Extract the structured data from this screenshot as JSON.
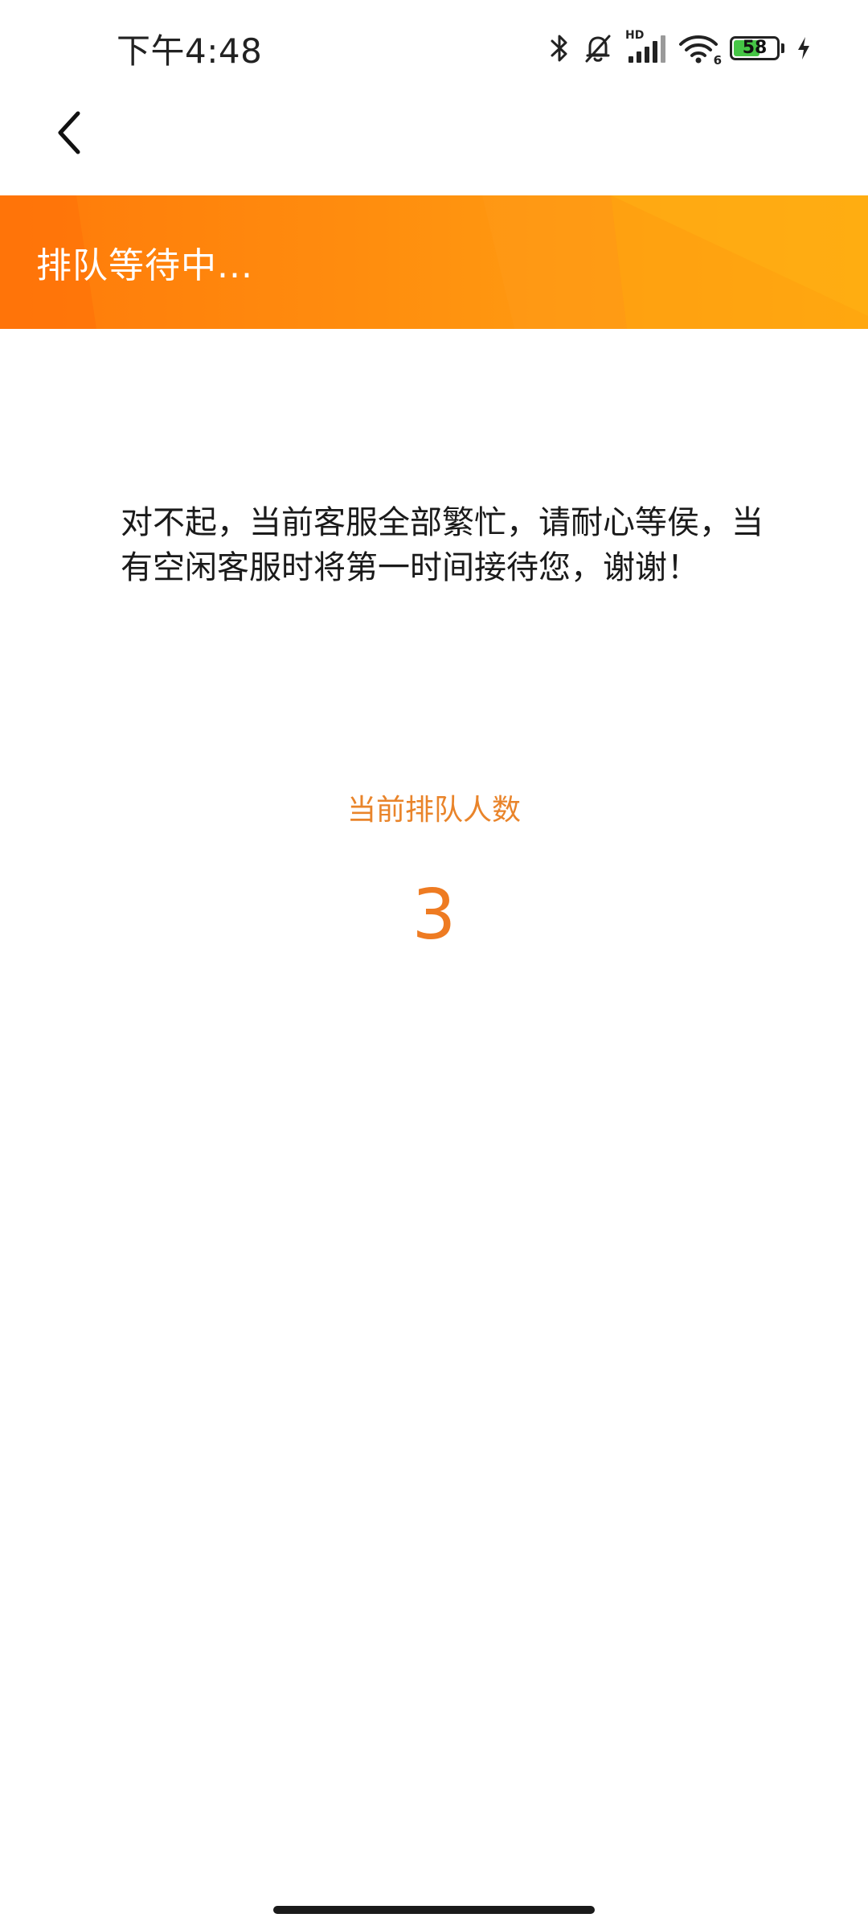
{
  "status_bar": {
    "time": "下午4:48",
    "network_label": "HD",
    "wifi_label": "6",
    "battery_level": "58",
    "battery_fraction": 0.58
  },
  "nav": {
    "back_icon": "chevron-left-icon"
  },
  "banner": {
    "title": "排队等待中...",
    "colors": [
      "#ff7a0a",
      "#ffab0d"
    ]
  },
  "content": {
    "message": "对不起，当前客服全部繁忙，请耐心等侯，当有空闲客服时将第一时间接待您，谢谢！",
    "queue_label": "当前排队人数",
    "queue_count": "3",
    "accent_color": "#ee7b22"
  }
}
